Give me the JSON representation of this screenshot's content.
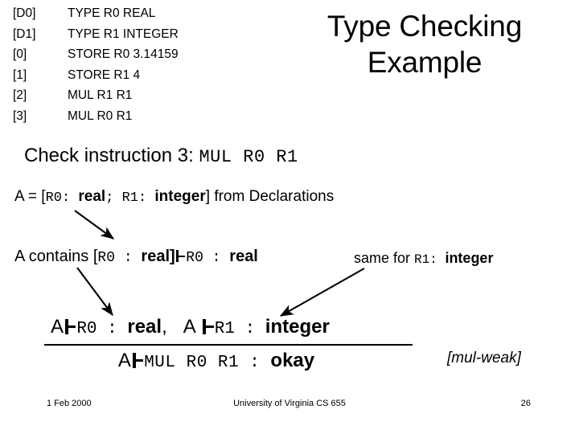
{
  "title": {
    "line1": "Type Checking",
    "line2": "Example"
  },
  "listing": {
    "rows": [
      {
        "label": "[D0]",
        "text": "TYPE R0 REAL"
      },
      {
        "label": "[D1]",
        "text": "TYPE R1 INTEGER"
      },
      {
        "label": "[0]",
        "text": "STORE R0 3.14159"
      },
      {
        "label": "[1]",
        "text": "STORE R1 4"
      },
      {
        "label": "[2]",
        "text": "MUL R1 R1"
      },
      {
        "label": "[3]",
        "text": "MUL R0 R1"
      }
    ]
  },
  "check_line": {
    "prefix": "Check instruction 3:",
    "instruction": "MUL R0 R1"
  },
  "declarations_line": {
    "prefix": "A = [",
    "reg0": "R0",
    "colon0": ": ",
    "type0": "real",
    "sep": "; ",
    "reg1": "R1",
    "colon1": ": ",
    "type1": "integer",
    "suffix": "] from Declarations"
  },
  "contains_line": {
    "prefix": "A contains [",
    "reg": "R0",
    "colon": " : ",
    "type": "real",
    "bracket": "]",
    "reg_right": "R0",
    "colon_right": " : ",
    "type_right": "real"
  },
  "same_for_note": {
    "prefix": "same for ",
    "reg": "R1",
    "colon": ": ",
    "type": "integer"
  },
  "rule": {
    "premise_left": {
      "context": "A",
      "reg": "R0",
      "colon": " : ",
      "type": "real",
      "comma": ","
    },
    "premise_right": {
      "context": "A",
      "reg": "R1",
      "colon": " : ",
      "type": "integer"
    },
    "conclusion": {
      "context": "A",
      "instruction": "MUL R0 R1",
      "colon": " : ",
      "type": "okay"
    },
    "name": "[mul-weak]"
  },
  "footer": {
    "date": "1 Feb 2000",
    "center": "University of Virginia CS 655",
    "page": "26"
  },
  "colors": {
    "background": "#ffffff",
    "text": "#000000",
    "rule_bar": "#000000",
    "arrow": "#000000"
  }
}
